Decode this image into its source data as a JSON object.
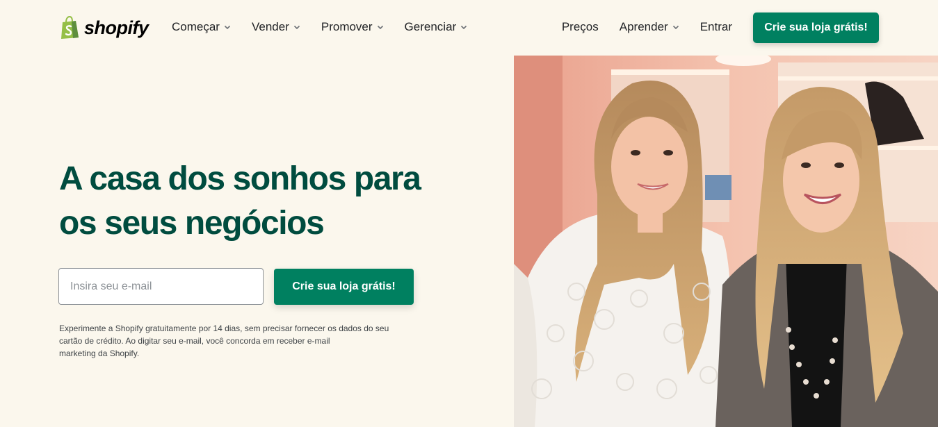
{
  "header": {
    "logo_text": "shopify",
    "nav_left": [
      {
        "label": "Começar",
        "has_dropdown": true
      },
      {
        "label": "Vender",
        "has_dropdown": true
      },
      {
        "label": "Promover",
        "has_dropdown": true
      },
      {
        "label": "Gerenciar",
        "has_dropdown": true
      }
    ],
    "nav_right": {
      "pricing": "Preços",
      "learn": "Aprender",
      "login": "Entrar"
    },
    "cta_label": "Crie sua loja grátis!"
  },
  "hero": {
    "title_line1": "A casa dos sonhos para",
    "title_line2": "os seus negócios",
    "email_placeholder": "Insira seu e-mail",
    "cta_label": "Crie sua loja grátis!",
    "disclaimer_line1": "Experimente a Shopify gratuitamente por 14 dias, sem precisar fornecer os dados do seu",
    "disclaimer_line2": "cartão de crédito. Ao digitar seu e-mail, você concorda em receber e-mail",
    "disclaimer_line3": "marketing da Shopify."
  },
  "colors": {
    "background": "#fbf7ed",
    "brand_green": "#008060",
    "title_green": "#004c3f",
    "logo_green": "#95bf47"
  },
  "icons": [
    "shopify-bag-icon",
    "chevron-down-icon"
  ]
}
